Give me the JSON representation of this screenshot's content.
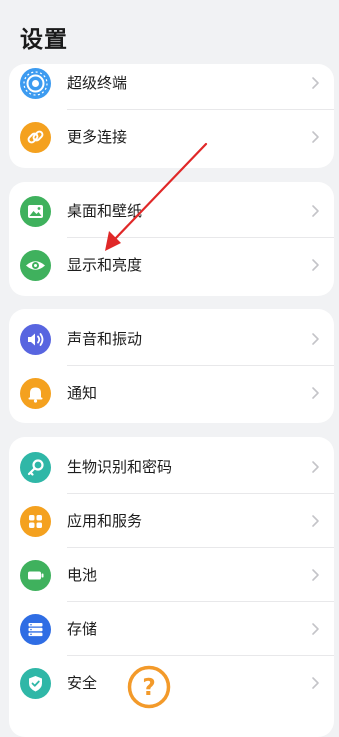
{
  "title": "设置",
  "groups": [
    {
      "items": [
        {
          "label": "超级终端",
          "icon": "super-device-icon",
          "color": "#3d9bf0"
        },
        {
          "label": "更多连接",
          "icon": "link-icon",
          "color": "#f4a11f"
        }
      ]
    },
    {
      "items": [
        {
          "label": "桌面和壁纸",
          "icon": "wallpaper-icon",
          "color": "#3fb15d"
        },
        {
          "label": "显示和亮度",
          "icon": "eye-icon",
          "color": "#3fb15d"
        }
      ]
    },
    {
      "items": [
        {
          "label": "声音和振动",
          "icon": "speaker-icon",
          "color": "#5865e0"
        },
        {
          "label": "通知",
          "icon": "bell-icon",
          "color": "#f4a11f"
        }
      ]
    },
    {
      "items": [
        {
          "label": "生物识别和密码",
          "icon": "key-icon",
          "color": "#2fb7a7"
        },
        {
          "label": "应用和服务",
          "icon": "apps-grid-icon",
          "color": "#f4a11f"
        },
        {
          "label": "电池",
          "icon": "battery-icon",
          "color": "#3fb15d"
        },
        {
          "label": "存储",
          "icon": "storage-icon",
          "color": "#2f6de4"
        },
        {
          "label": "安全",
          "icon": "shield-icon",
          "color": "#2fb7a7"
        }
      ]
    }
  ],
  "help_badge": {
    "glyph": "?",
    "color": "#f39a2a"
  },
  "annotation": {
    "arrow_color": "#e02828"
  }
}
